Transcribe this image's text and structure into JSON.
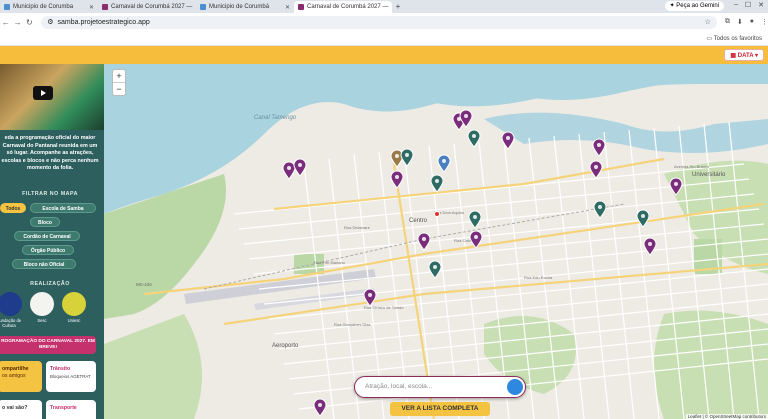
{
  "browser": {
    "tabs": [
      {
        "label": "Municipio de Corumba",
        "active": false
      },
      {
        "label": "Carnaval de Corumbá 2027 — ",
        "active": false
      },
      {
        "label": "Municipio de Corumbá",
        "active": false
      },
      {
        "label": "Carnaval de Corumbá 2027 — ",
        "active": true
      }
    ],
    "new_tab": "+",
    "gemini_label": "Peça ao Gemini",
    "url": "samba.projetoestrategico.app",
    "bookmarks_label": "Todos os favoritos"
  },
  "header": {
    "data_button": "DATA"
  },
  "sidebar": {
    "intro_text": "eda a programação oficial do maior Carnaval do Pantanal reunida em um só lugar. Acompanhe as atrações, escolas e blocos e não perca nenhum momento da folia.",
    "filter_title": "FILTRAR NO MAPA",
    "filters": [
      "Todos",
      "Escola de Samba",
      "Bloco",
      "Cordão de Carnaval",
      "Órgão Público",
      "Bloco não Oficial"
    ],
    "sponsors_title": "REALIZAÇÃO",
    "sponsors": [
      "Fundação de Cultura",
      "Sesc",
      "Uniesc"
    ],
    "promo_text": "ROGRAMAÇÃO DO CARNAVAL 2027. EM BREVE!",
    "cards": [
      {
        "title": "ompartilhe",
        "subtitle": "os amigos"
      },
      {
        "title": "Trânsito",
        "subtitle": "Bloqueios AGETRAT"
      },
      {
        "title": "o vai são?",
        "subtitle": ""
      },
      {
        "title": "Transporte",
        "subtitle": ""
      }
    ]
  },
  "map": {
    "zoom_in": "+",
    "zoom_out": "−",
    "labels": {
      "river": "Canal Tamengo",
      "centro": "Centro",
      "universitario": "Universitário",
      "aeroporto": "Aeroporto",
      "highway": "MS-426",
      "r1": "Rua Delamare",
      "r2": "Rua Dom Aquino",
      "r3": "Rua Frei Mariano",
      "r4": "Rua Cabral",
      "r5": "Avenida Rio Branco",
      "r6": "Rua Ciríaco de Toledo",
      "r7": "Rua Edu Rocha",
      "r8": "Rua Gonçalves Dias"
    },
    "search_placeholder": "Atração, local, escola...",
    "list_button": "VER A LISTA COMPLETA",
    "attribution": "Leaflet | © OpenStreetMap contributors"
  },
  "colors": {
    "header": "#f6bd3c",
    "sidebar": "#2d5f5f",
    "marker_purple": "#7a2d7a",
    "marker_teal": "#2d6b64",
    "accent_pink": "#c5316d"
  }
}
